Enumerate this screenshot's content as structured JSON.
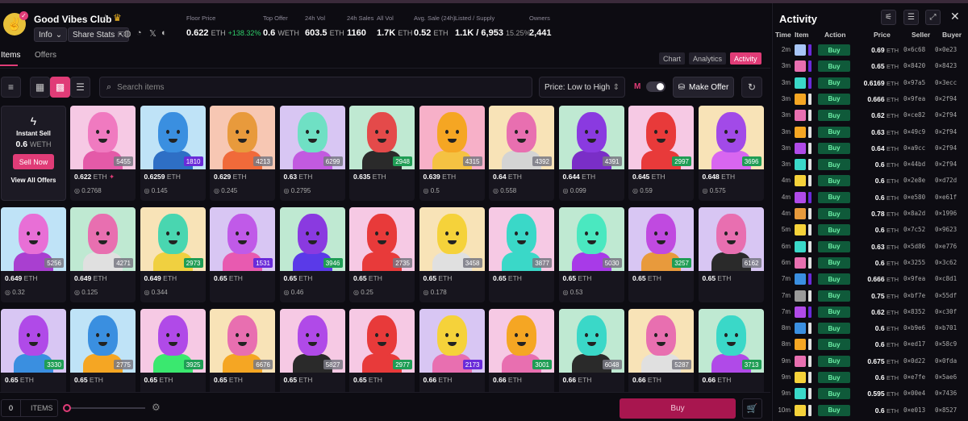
{
  "collection": {
    "name": "Good Vibes Club",
    "info_label": "Info",
    "share_label": "Share Stats"
  },
  "stats": [
    {
      "label": "Floor Price",
      "value": "0.622",
      "unit": "ETH",
      "extra": "+138.32%"
    },
    {
      "label": "Top Offer",
      "value": "0.6",
      "unit": "WETH",
      "extra": ""
    },
    {
      "label": "24h Vol",
      "value": "603.5",
      "unit": "ETH",
      "extra": ""
    },
    {
      "label": "24h Sales",
      "value": "1160",
      "unit": "",
      "extra": ""
    },
    {
      "label": "All Vol",
      "value": "1.7K",
      "unit": "ETH",
      "extra": ""
    },
    {
      "label": "Avg. Sale (24h)",
      "value": "0.52",
      "unit": "ETH",
      "extra": ""
    },
    {
      "label": "Listed / Supply",
      "value": "1.1K / 6,953",
      "unit": "",
      "extra": "15.25%"
    },
    {
      "label": "Owners",
      "value": "2,441",
      "unit": "",
      "extra": ""
    }
  ],
  "tabs": {
    "items": "Items",
    "offers": "Offers"
  },
  "view_tabs": {
    "chart": "Chart",
    "analytics": "Analytics",
    "activity": "Activity"
  },
  "toolbar": {
    "search_placeholder": "Search items",
    "sort_label": "Price: Low to High",
    "m_label": "M",
    "make_offer": "Make Offer"
  },
  "instant_sell": {
    "title": "Instant Sell",
    "price": "0.6",
    "unit": "WETH",
    "button": "Sell Now",
    "view_all": "View All Offers"
  },
  "colors": {
    "accent": "#e03c77",
    "green": "#1f9d55",
    "purple": "#6a2bd9"
  },
  "nfts": [
    {
      "id": "5455",
      "price": "0.622",
      "last": "0.2768",
      "badge": "gray",
      "bg": "#f6c9e4",
      "skin": "#f07ac0",
      "cloth": "#e45aa8",
      "flag": "sparkle"
    },
    {
      "id": "1810",
      "price": "0.6259",
      "last": "0.145",
      "badge": "purple",
      "bg": "#bfe3f7",
      "skin": "#3a8fe0",
      "cloth": "#2e6fc5"
    },
    {
      "id": "4213",
      "price": "0.629",
      "last": "0.245",
      "badge": "gray",
      "bg": "#f7c7b3",
      "skin": "#e89a3c",
      "cloth": "#f06a3a"
    },
    {
      "id": "6299",
      "price": "0.63",
      "last": "0.2795",
      "badge": "gray",
      "bg": "#d8c6f3",
      "skin": "#6fe0c4",
      "cloth": "#c25ae0"
    },
    {
      "id": "2948",
      "price": "0.635",
      "last": "",
      "badge": "green",
      "bg": "#bfe9d2",
      "skin": "#e44a4a",
      "cloth": "#2a2a2a"
    },
    {
      "id": "4315",
      "price": "0.639",
      "last": "0.5",
      "badge": "gray",
      "bg": "#f7b0c8",
      "skin": "#f5a623",
      "cloth": "#f5c242"
    },
    {
      "id": "4392",
      "price": "0.64",
      "last": "0.558",
      "badge": "gray",
      "bg": "#f8e3b7",
      "skin": "#e86fb0",
      "cloth": "#d4d4d4"
    },
    {
      "id": "4391",
      "price": "0.644",
      "last": "0.099",
      "badge": "gray",
      "bg": "#bfe9d2",
      "skin": "#8a3ae0",
      "cloth": "#7a2ec7"
    },
    {
      "id": "2997",
      "price": "0.645",
      "last": "0.59",
      "badge": "green",
      "bg": "#f6c9e4",
      "skin": "#e83a3a",
      "cloth": "#e83a3a"
    },
    {
      "id": "3696",
      "price": "0.648",
      "last": "0.575",
      "badge": "green",
      "bg": "#f8e3b7",
      "skin": "#a24ae8",
      "cloth": "#d866f0"
    },
    {
      "id": "5256",
      "price": "0.649",
      "last": "0.32",
      "badge": "gray",
      "bg": "#bfe3f7",
      "skin": "#e86fd6",
      "cloth": "#a93fd0"
    },
    {
      "id": "4271",
      "price": "0.649",
      "last": "0.125",
      "badge": "gray",
      "bg": "#bfe9d2",
      "skin": "#e86fb0",
      "cloth": "#e0e0e0"
    },
    {
      "id": "2973",
      "price": "0.649",
      "last": "0.344",
      "badge": "green",
      "bg": "#f8e3b7",
      "skin": "#49d6b0",
      "cloth": "#f0d040"
    },
    {
      "id": "1531",
      "price": "0.65",
      "last": "",
      "badge": "purple",
      "bg": "#d8c6f3",
      "skin": "#c05ae8",
      "cloth": "#e85ab0"
    },
    {
      "id": "3946",
      "price": "0.65",
      "last": "0.46",
      "badge": "green",
      "bg": "#bfe9d2",
      "skin": "#8a3ae0",
      "cloth": "#5a3ae8"
    },
    {
      "id": "2735",
      "price": "0.65",
      "last": "0.25",
      "badge": "gray",
      "bg": "#f6c9e4",
      "skin": "#e83a3a",
      "cloth": "#e83a3a"
    },
    {
      "id": "3458",
      "price": "0.65",
      "last": "0.178",
      "badge": "gray",
      "bg": "#f8e3b7",
      "skin": "#f5d23a",
      "cloth": "#e0e0e0"
    },
    {
      "id": "3877",
      "price": "0.65",
      "last": "",
      "badge": "gray",
      "bg": "#f6c9e4",
      "skin": "#3ad8c8",
      "cloth": "#3ad8c8"
    },
    {
      "id": "5030",
      "price": "0.65",
      "last": "0.53",
      "badge": "gray",
      "bg": "#bfe9d2",
      "skin": "#4ae8c0",
      "cloth": "#a83ae8"
    },
    {
      "id": "3257",
      "price": "0.65",
      "last": "",
      "badge": "green",
      "bg": "#d8c6f3",
      "skin": "#c04ae0",
      "cloth": "#e89a3c"
    },
    {
      "id": "6162",
      "price": "0.65",
      "last": "",
      "badge": "gray",
      "bg": "#d8c6f3",
      "skin": "#e86fb0",
      "cloth": "#2a2a2a"
    },
    {
      "id": "3330",
      "price": "0.65",
      "last": "",
      "badge": "green",
      "bg": "#d8c6f3",
      "skin": "#b04ae8",
      "cloth": "#3a8fe0"
    },
    {
      "id": "2775",
      "price": "0.65",
      "last": "",
      "badge": "gray",
      "bg": "#bfe3f7",
      "skin": "#3a8fe0",
      "cloth": "#f5a623"
    },
    {
      "id": "3925",
      "price": "0.65",
      "last": "",
      "badge": "green",
      "bg": "#f6c9e4",
      "skin": "#b04ae8",
      "cloth": "#3ae86f"
    },
    {
      "id": "6676",
      "price": "0.65",
      "last": "",
      "badge": "gray",
      "bg": "#f8e3b7",
      "skin": "#e86fb0",
      "cloth": "#f5a623"
    },
    {
      "id": "5827",
      "price": "0.65",
      "last": "",
      "badge": "gray",
      "bg": "#f6c9e4",
      "skin": "#b04ae8",
      "cloth": "#2a2a2a"
    },
    {
      "id": "2977",
      "price": "0.65",
      "last": "",
      "badge": "green",
      "bg": "#f6c9e4",
      "skin": "#e83a3a",
      "cloth": "#e83a3a"
    },
    {
      "id": "2173",
      "price": "0.66",
      "last": "",
      "badge": "purple",
      "bg": "#d8c6f3",
      "skin": "#f5d23a",
      "cloth": "#e86fb0"
    },
    {
      "id": "3001",
      "price": "0.66",
      "last": "",
      "badge": "green",
      "bg": "#f6c9e4",
      "skin": "#f5a623",
      "cloth": "#e86fb0"
    },
    {
      "id": "6048",
      "price": "0.66",
      "last": "",
      "badge": "gray",
      "bg": "#bfe9d2",
      "skin": "#3ad8c8",
      "cloth": "#2a2a2a"
    },
    {
      "id": "5287",
      "price": "0.66",
      "last": "",
      "badge": "gray",
      "bg": "#f8e3b7",
      "skin": "#e86fb0",
      "cloth": "#e0e0e0"
    },
    {
      "id": "3713",
      "price": "0.66",
      "last": "",
      "badge": "green",
      "bg": "#bfe9d2",
      "skin": "#3ad8c8",
      "cloth": "#b04ae8"
    }
  ],
  "bottom": {
    "qty": "0",
    "items_label": "ITEMS",
    "buy_label": "Buy"
  },
  "activity": {
    "title": "Activity",
    "headers": {
      "time": "Time",
      "item": "Item",
      "action": "Action",
      "price": "Price",
      "seller": "Seller",
      "buyer": "Buyer"
    },
    "rows": [
      {
        "t": "2m",
        "a": "Buy",
        "p": "0.69",
        "s": "0×6c68",
        "b": "0×0e23",
        "av": "#a8c6f7",
        "bar": "#6a2bd9"
      },
      {
        "t": "3m",
        "a": "Buy",
        "p": "0.65",
        "s": "0×8420",
        "b": "0×8423",
        "av": "#e86fb0",
        "bar": "#6a2bd9"
      },
      {
        "t": "3m",
        "a": "Buy",
        "p": "0.6169",
        "s": "0×97a5",
        "b": "0×3ecc",
        "av": "#3ad8c8",
        "bar": "#6a2bd9"
      },
      {
        "t": "3m",
        "a": "Buy",
        "p": "0.666",
        "s": "0×9fea",
        "b": "0×2f94",
        "av": "#f5a623",
        "bar": "#e0e0e0"
      },
      {
        "t": "3m",
        "a": "Buy",
        "p": "0.62",
        "s": "0×ce82",
        "b": "0×2f94",
        "av": "#e86fb0",
        "bar": "#e0e0e0"
      },
      {
        "t": "3m",
        "a": "Buy",
        "p": "0.63",
        "s": "0×49c9",
        "b": "0×2f94",
        "av": "#f5a623",
        "bar": "#e0e0e0"
      },
      {
        "t": "3m",
        "a": "Buy",
        "p": "0.64",
        "s": "0×a9cc",
        "b": "0×2f94",
        "av": "#b04ae8",
        "bar": "#e0e0e0"
      },
      {
        "t": "3m",
        "a": "Buy",
        "p": "0.6",
        "s": "0×44bd",
        "b": "0×2f94",
        "av": "#3ad8c8",
        "bar": "#e0e0e0"
      },
      {
        "t": "4m",
        "a": "Buy",
        "p": "0.6",
        "s": "0×2e8e",
        "b": "0×d72d",
        "av": "#f5d23a",
        "bar": "#e0e0e0"
      },
      {
        "t": "4m",
        "a": "Buy",
        "p": "0.6",
        "s": "0×e580",
        "b": "0×e61f",
        "av": "#b04ae8",
        "bar": "#6a2bd9"
      },
      {
        "t": "4m",
        "a": "Buy",
        "p": "0.78",
        "s": "0×8a2d",
        "b": "0×1996",
        "av": "#e89a3c",
        "bar": "#e0e0e0"
      },
      {
        "t": "5m",
        "a": "Buy",
        "p": "0.6",
        "s": "0×7c52",
        "b": "0×9623",
        "av": "#f5d23a",
        "bar": "#e0e0e0"
      },
      {
        "t": "6m",
        "a": "Buy",
        "p": "0.63",
        "s": "0×5d86",
        "b": "0×e776",
        "av": "#3ad8c8",
        "bar": "#e0e0e0"
      },
      {
        "t": "6m",
        "a": "Buy",
        "p": "0.6",
        "s": "0×3255",
        "b": "0×3c62",
        "av": "#e86fb0",
        "bar": "#e0e0e0"
      },
      {
        "t": "7m",
        "a": "Buy",
        "p": "0.666",
        "s": "0×9fea",
        "b": "0×c8d1",
        "av": "#3a8fe0",
        "bar": "#6a2bd9"
      },
      {
        "t": "7m",
        "a": "Buy",
        "p": "0.75",
        "s": "0×bf7e",
        "b": "0×55df",
        "av": "#9a9a9a",
        "bar": "#e0e0e0"
      },
      {
        "t": "7m",
        "a": "Buy",
        "p": "0.62",
        "s": "0×8352",
        "b": "0×c30f",
        "av": "#b04ae8",
        "bar": "#6a2bd9"
      },
      {
        "t": "8m",
        "a": "Buy",
        "p": "0.6",
        "s": "0×b9e6",
        "b": "0×b701",
        "av": "#3a8fe0",
        "bar": "#e0e0e0"
      },
      {
        "t": "8m",
        "a": "Buy",
        "p": "0.6",
        "s": "0×ed17",
        "b": "0×58c9",
        "av": "#f5a623",
        "bar": "#e0e0e0"
      },
      {
        "t": "9m",
        "a": "Buy",
        "p": "0.675",
        "s": "0×0d22",
        "b": "0×0fda",
        "av": "#e86fb0",
        "bar": "#e0e0e0"
      },
      {
        "t": "9m",
        "a": "Buy",
        "p": "0.6",
        "s": "0×e7fe",
        "b": "0×5ae6",
        "av": "#f5d23a",
        "bar": "#e0e0e0"
      },
      {
        "t": "9m",
        "a": "Buy",
        "p": "0.595",
        "s": "0×00e4",
        "b": "0×7436",
        "av": "#3ad8c8",
        "bar": "#e0e0e0"
      },
      {
        "t": "10m",
        "a": "Buy",
        "p": "0.6",
        "s": "0×e013",
        "b": "0×8527",
        "av": "#f5d23a",
        "bar": "#e0e0e0"
      }
    ]
  }
}
